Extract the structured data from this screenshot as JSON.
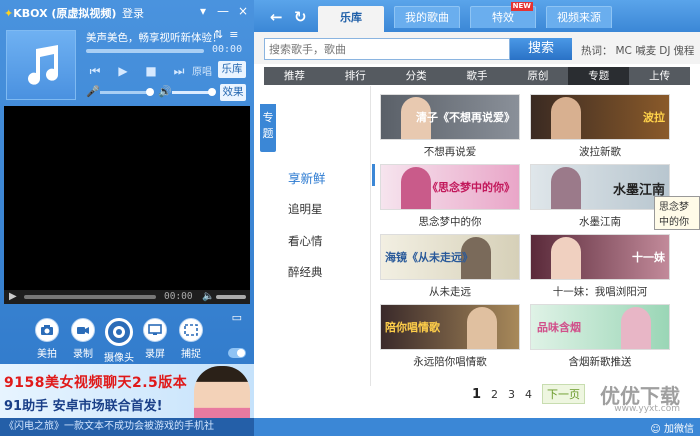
{
  "app": {
    "logo": "KBOX (原虚拟视频)",
    "login": "登录",
    "win_controls": [
      "▾",
      "—",
      "×"
    ]
  },
  "player": {
    "song_title": "美声美色，畅享视听新体验！",
    "time": "00:00",
    "btn_original": "原唱",
    "btn_library": "乐库",
    "btn_effect": "效果"
  },
  "video_bar": {
    "time": "00:00"
  },
  "tools": [
    {
      "label": "美拍"
    },
    {
      "label": "录制"
    },
    {
      "label": "摄像头"
    },
    {
      "label": "录屏"
    },
    {
      "label": "捕捉"
    }
  ],
  "banner": {
    "line1": "9158美女视频聊天2.5版本",
    "line2": "91助手 安卓市场联合首发!"
  },
  "ticker": "《闪电之旅》一款文本不成功会被游戏的手机社",
  "right": {
    "tabs": [
      {
        "label": "乐库",
        "active": true
      },
      {
        "label": "我的歌曲"
      },
      {
        "label": "特效",
        "badge": "NEW"
      },
      {
        "label": "视频来源"
      }
    ],
    "search_placeholder": "搜索歌手，歌曲",
    "search_button": "搜索",
    "hot_label": "热词：",
    "hot_words": [
      "MC 喊麦",
      "DJ",
      "傀程"
    ],
    "categories": [
      {
        "label": "推荐"
      },
      {
        "label": "排行"
      },
      {
        "label": "分类"
      },
      {
        "label": "歌手"
      },
      {
        "label": "原创"
      },
      {
        "label": "专题",
        "active": true
      },
      {
        "label": "上传"
      }
    ],
    "side_tab": "专题",
    "side_items": [
      {
        "label": "享新鲜",
        "active": true
      },
      {
        "label": "追明星"
      },
      {
        "label": "看心情"
      },
      {
        "label": "醉经典"
      }
    ],
    "cards": [
      {
        "caption": "不想再说爱",
        "thumb_text": "清子《不想再说爱》"
      },
      {
        "caption": "波拉新歌",
        "thumb_text": "波拉"
      },
      {
        "caption": "思念梦中的你",
        "thumb_text": "《思念梦中的你》"
      },
      {
        "caption": "水墨江南",
        "thumb_text": "水墨江南"
      },
      {
        "caption": "从未走远",
        "thumb_text": "海镜《从未走远》"
      },
      {
        "caption": "十一妹：我唱浏阳河",
        "thumb_text": "十一妹"
      },
      {
        "caption": "永远陪你唱情歌",
        "thumb_text": "陪你唱情歌"
      },
      {
        "caption": "含烟新歌推送",
        "thumb_text": "品味含烟"
      }
    ],
    "tooltip": "思念梦中的你",
    "pager": {
      "pages": [
        "1",
        "2",
        "3",
        "4"
      ],
      "next": "下一页"
    },
    "watermark": "优优下载",
    "watermark_url": "www.yyxt.com",
    "wechat": "加微信"
  }
}
